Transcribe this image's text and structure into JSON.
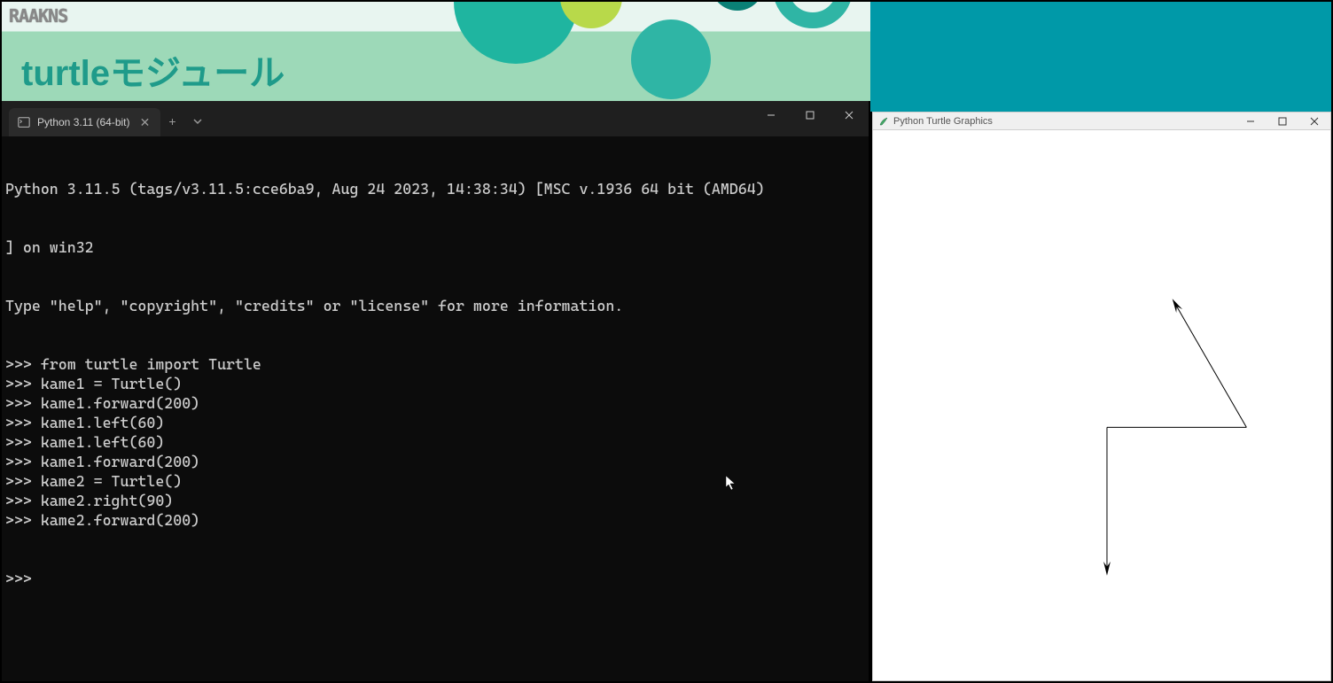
{
  "header": {
    "logo_text": "RAAKNS",
    "title": "turtleモジュール"
  },
  "terminal": {
    "tab_title": "Python 3.11 (64-bit)",
    "banner_line1": "Python 3.11.5 (tags/v3.11.5:cce6ba9, Aug 24 2023, 14:38:34) [MSC v.1936 64 bit (AMD64)",
    "banner_line2": "] on win32",
    "banner_line3": "Type \"help\", \"copyright\", \"credits\" or \"license\" for more information.",
    "prompt": ">>> ",
    "lines": [
      "from turtle import Turtle",
      "kame1 = Turtle()",
      "kame1.forward(200)",
      "kame1.left(60)",
      "kame1.left(60)",
      "kame1.forward(200)",
      "kame2 = Turtle()",
      "kame2.right(90)",
      "kame2.forward(200)"
    ],
    "final_prompt": ">>> "
  },
  "turtle_window": {
    "title": "Python Turtle Graphics"
  }
}
